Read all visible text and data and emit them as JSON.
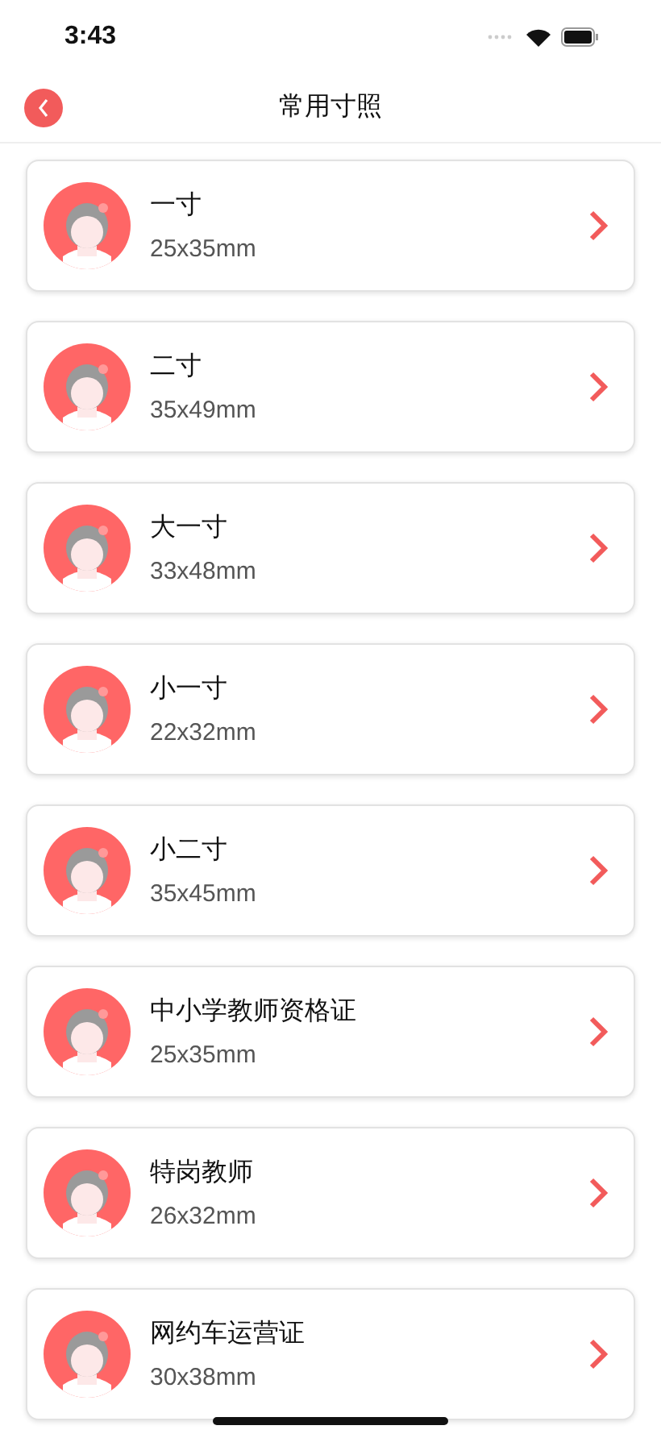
{
  "status_bar": {
    "time": "3:43"
  },
  "nav": {
    "title": "常用寸照"
  },
  "items": [
    {
      "name": "一寸",
      "size": "25x35mm"
    },
    {
      "name": "二寸",
      "size": "35x49mm"
    },
    {
      "name": "大一寸",
      "size": "33x48mm"
    },
    {
      "name": "小一寸",
      "size": "22x32mm"
    },
    {
      "name": "小二寸",
      "size": "35x45mm"
    },
    {
      "name": "中小学教师资格证",
      "size": "25x35mm"
    },
    {
      "name": "特岗教师",
      "size": "26x32mm"
    },
    {
      "name": "网约车运营证",
      "size": "30x38mm"
    }
  ]
}
